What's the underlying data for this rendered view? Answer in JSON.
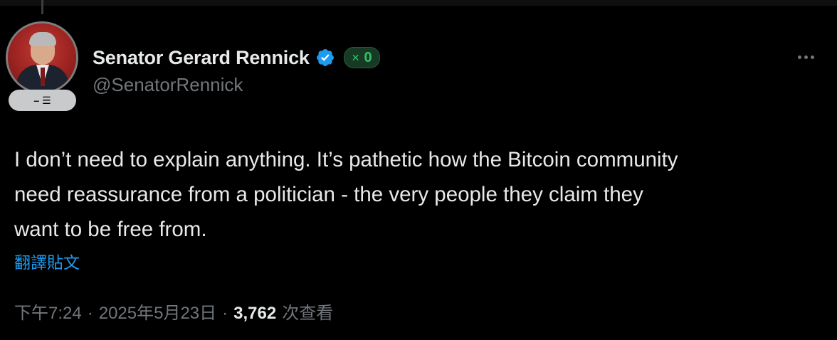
{
  "author": {
    "display_name": "Senator Gerard Rennick",
    "handle": "@SenatorRennick",
    "verified": true,
    "score_value": "0",
    "badge_text": "– ☰"
  },
  "tweet": {
    "text": "I don’t need to explain anything. It’s pathetic how the Bitcoin community\nneed reassurance from a politician - the very people they claim they\nwant to be free from.",
    "translate_label": "翻譯貼文"
  },
  "meta": {
    "time": "下午7:24",
    "separator": "·",
    "date": "2025年5月23日",
    "views": "3,762",
    "views_label": "次查看"
  },
  "colors": {
    "background": "#000000",
    "text": "#e7e9ea",
    "muted": "#71767b",
    "link": "#1d9bf0",
    "verified": "#1d9bf0",
    "score": "#34c06a"
  }
}
